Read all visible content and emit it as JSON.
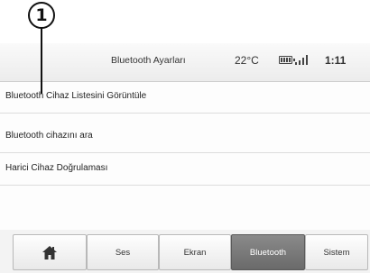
{
  "callout": {
    "number": "1"
  },
  "status": {
    "title": "Bluetooth Ayarları",
    "temperature": "22°C",
    "time": "1:11"
  },
  "menu": {
    "items": [
      {
        "label": "Bluetooth Cihaz Listesini Görüntüle"
      },
      {
        "label": "Bluetooth cihazını ara"
      },
      {
        "label": "Harici Cihaz Doğrulaması"
      }
    ]
  },
  "tabs": [
    {
      "label": "",
      "icon": "home-icon"
    },
    {
      "label": "Ses"
    },
    {
      "label": "Ekran"
    },
    {
      "label": "Bluetooth",
      "active": true
    },
    {
      "label": "Sistem"
    }
  ]
}
